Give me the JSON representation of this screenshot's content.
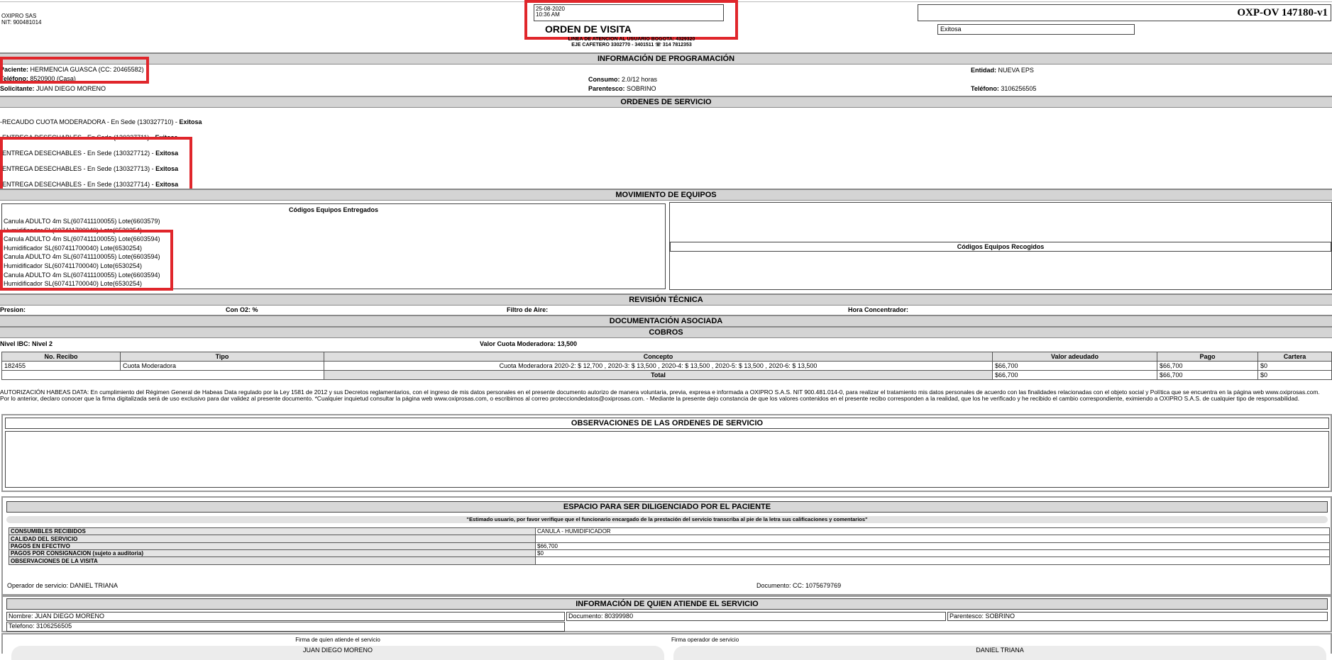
{
  "header": {
    "company": "OXIPRO SAS",
    "nit": "NIT: 900481014",
    "date": "25-08-2020",
    "time": "10:36 AM",
    "title": "ORDEN DE VISITA",
    "contact_line1": "LINEA DE ATENCION AL USUARIO BOGOTA: 4329320",
    "contact_line2": "EJE CAFETERO 3302770 - 3401511 ☏ 314 7812353",
    "order_id": "OXP-OV 147180-v1",
    "status": "Exitosa"
  },
  "programacion": {
    "title": "INFORMACIÓN DE PROGRAMACIÓN",
    "paciente_label": "Paciente:",
    "paciente": "HERMENCIA GUASCA (CC: 20465582)",
    "telefono_paciente_label": "Teléfono:",
    "telefono_paciente": "8520900 (Casa)",
    "solicitante_label": "Solicitante:",
    "solicitante": "JUAN DIEGO MORENO",
    "consumo_label": "Consumo:",
    "consumo": "2.0/12 horas",
    "parentesco_label": "Parentesco:",
    "parentesco": "SOBRINO",
    "entidad_label": "Entidad:",
    "entidad": "NUEVA EPS",
    "telefono_label": "Teléfono:",
    "telefono": "3106256505"
  },
  "ordenes": {
    "title": "ORDENES DE SERVICIO",
    "items": [
      {
        "text": "-RECAUDO CUOTA MODERADORA - En Sede (130327710)  -",
        "status": "Exitosa"
      },
      {
        "text": "-ENTREGA DESECHABLES - En Sede (130327711)  -",
        "status": "Exitosa"
      },
      {
        "text": "-ENTREGA DESECHABLES - En Sede (130327712)  -",
        "status": "Exitosa"
      },
      {
        "text": "-ENTREGA DESECHABLES - En Sede (130327713)  -",
        "status": "Exitosa"
      },
      {
        "text": "-ENTREGA DESECHABLES - En Sede (130327714)  -",
        "status": "Exitosa"
      }
    ]
  },
  "equipos": {
    "title": "MOVIMIENTO DE EQUIPOS",
    "entregados_title": "Códigos Equipos Entregados",
    "entregados": [
      "Canula ADULTO 4m SL(607411100055) Lote(6603579)",
      "Humidificador SL(607411700040) Lote(6530254)",
      "Canula ADULTO 4m SL(607411100055) Lote(6603594)",
      "Humidificador SL(607411700040) Lote(6530254)",
      "Canula ADULTO 4m SL(607411100055) Lote(6603594)",
      "Humidificador SL(607411700040) Lote(6530254)",
      "Canula ADULTO 4m SL(607411100055) Lote(6603594)",
      "Humidificador SL(607411700040) Lote(6530254)"
    ],
    "recogidos_title": "Códigos Equipos Recogidos"
  },
  "revision": {
    "title": "REVISIÓN TÉCNICA",
    "presion": "Presion:",
    "con_o2": "Con O2: %",
    "filtro": "Filtro de Aire:",
    "hora": "Hora Concentrador:"
  },
  "documentacion": {
    "title": "DOCUMENTACIÓN ASOCIADA"
  },
  "cobros": {
    "title": "COBROS",
    "nivel_ibc": "Nivel IBC: Nivel 2",
    "valor_cuota": "Valor Cuota Moderadora: 13,500",
    "headers": [
      "No. Recibo",
      "Tipo",
      "Concepto",
      "Valor adeudado",
      "Pago",
      "Cartera"
    ],
    "row": {
      "recibo": "182455",
      "tipo": "Cuota Moderadora",
      "concepto": "Cuota Moderadora 2020-2: $ 12,700 , 2020-3: $ 13,500 , 2020-4: $ 13,500 , 2020-5: $ 13,500 , 2020-6: $ 13,500",
      "valor": "$66,700",
      "pago": "$66,700",
      "cartera": "$0"
    },
    "total_label": "Total",
    "total": {
      "valor": "$66,700",
      "pago": "$66,700",
      "cartera": "$0"
    }
  },
  "habeas": "AUTORIZACIÓN HABEAS DATA: En cumplimiento del Régimen General de Habeas Data regulado por la Ley 1581 de 2012 y sus Decretos reglamentarios, con el ingreso de mis datos personales en el presente documento autorizo de manera voluntaria, previa, expresa e informada a OXIPRO S.A.S. NIT 900.481.014-0, para realizar el tratamiento mis datos personales de acuerdo con las finalidades relacionadas con el objeto social y Política que se encuentra en la página web www.oxiprosas.com. Por lo anterior, declaro conocer que la firma digitalizada será de uso exclusivo para dar validez al presente documento. *Cualquier inquietud consultar la página web www.oxiprosas.com, o escribirnos al correo protecciondedatos@oxiprosas.com. - Mediante la presente dejo constancia de que los valores contenidos en el presente recibo corresponden a la realidad, que los he verificado y he recibido el cambio correspondiente, eximiendo a OXIPRO S.A.S. de cualquier tipo de responsabilidad.",
  "observaciones": {
    "title": "OBSERVACIONES DE LAS ORDENES DE SERVICIO"
  },
  "paciente_space": {
    "title": "ESPACIO PARA SER DILIGENCIADO POR EL PACIENTE",
    "note": "\"Estimado usuario, por favor verifique que el funcionario encargado de la prestación del servicio transcriba al pie de la letra sus calificaciones y comentarios\"",
    "rows": [
      {
        "label": "CONSUMIBLES RECIBIDOS",
        "value": "CANULA - HUMIDIFICADOR"
      },
      {
        "label": "CALIDAD DEL SERVICIO",
        "value": ""
      },
      {
        "label": "PAGOS EN EFECTIVO",
        "value": "$66,700"
      },
      {
        "label": "PAGOS POR CONSIGNACION (sujeto a auditoria)",
        "value": "$0"
      },
      {
        "label": "OBSERVACIONES DE LA VISITA",
        "value": ""
      }
    ],
    "operador": "Operador de servicio: DANIEL TRIANA",
    "documento": "Documento: CC: 1075679769"
  },
  "atiende": {
    "title": "INFORMACIÓN DE QUIEN ATIENDE EL SERVICIO",
    "nombre": "Nombre: JUAN DIEGO MORENO",
    "documento": "Documento: 80399980",
    "parentesco": "Parentesco: SOBRINO",
    "telefono": "Telefono: 3106256505"
  },
  "firmas": {
    "atiende_label": "Firma de quien atiende el servicio",
    "atiende_name": "JUAN DIEGO MORENO",
    "operador_label": "Firma operador de servicio",
    "operador_name": "DANIEL TRIANA"
  }
}
